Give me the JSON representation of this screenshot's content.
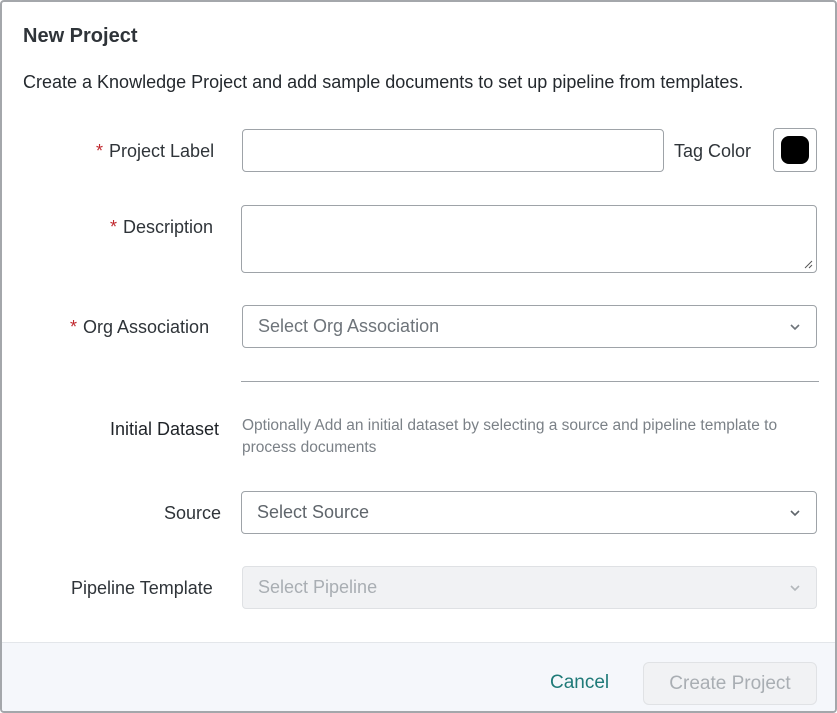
{
  "dialog": {
    "title": "New Project",
    "subtitle": "Create a Knowledge Project and add sample documents to set up pipeline from templates."
  },
  "form": {
    "required_marker": "*",
    "project_label": {
      "label": "Project Label",
      "value": ""
    },
    "tag_color": {
      "label": "Tag Color",
      "color": "#000000"
    },
    "description": {
      "label": "Description",
      "value": ""
    },
    "org_association": {
      "label": "Org Association",
      "placeholder": "Select Org Association"
    },
    "initial_dataset": {
      "label": "Initial Dataset",
      "hint": "Optionally Add an initial dataset by selecting a source and pipeline template to process documents"
    },
    "source": {
      "label": "Source",
      "placeholder": "Select Source"
    },
    "pipeline_template": {
      "label": "Pipeline Template",
      "placeholder": "Select Pipeline"
    }
  },
  "footer": {
    "cancel_label": "Cancel",
    "create_label": "Create Project"
  },
  "colors": {
    "required": "#c0272d",
    "accent": "#1f7a78",
    "disabled_text": "#a9aeb3"
  },
  "icons": {
    "dropdown": "chevron-down-icon",
    "resize": "resize-grip-icon"
  }
}
